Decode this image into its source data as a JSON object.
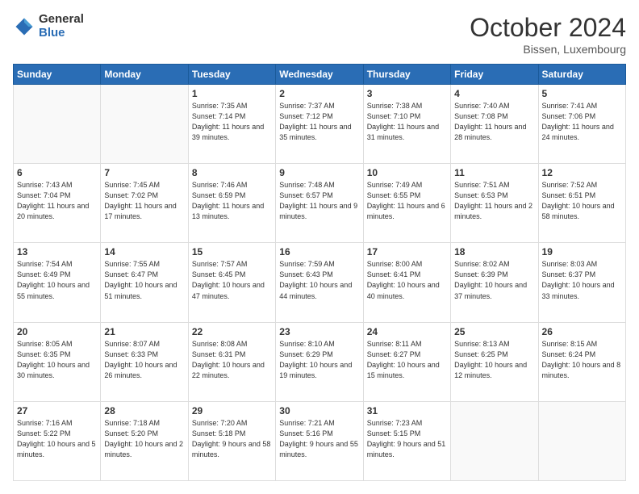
{
  "header": {
    "logo_general": "General",
    "logo_blue": "Blue",
    "month_title": "October 2024",
    "location": "Bissen, Luxembourg"
  },
  "days_of_week": [
    "Sunday",
    "Monday",
    "Tuesday",
    "Wednesday",
    "Thursday",
    "Friday",
    "Saturday"
  ],
  "weeks": [
    [
      {
        "day": "",
        "info": ""
      },
      {
        "day": "",
        "info": ""
      },
      {
        "day": "1",
        "info": "Sunrise: 7:35 AM\nSunset: 7:14 PM\nDaylight: 11 hours and 39 minutes."
      },
      {
        "day": "2",
        "info": "Sunrise: 7:37 AM\nSunset: 7:12 PM\nDaylight: 11 hours and 35 minutes."
      },
      {
        "day": "3",
        "info": "Sunrise: 7:38 AM\nSunset: 7:10 PM\nDaylight: 11 hours and 31 minutes."
      },
      {
        "day": "4",
        "info": "Sunrise: 7:40 AM\nSunset: 7:08 PM\nDaylight: 11 hours and 28 minutes."
      },
      {
        "day": "5",
        "info": "Sunrise: 7:41 AM\nSunset: 7:06 PM\nDaylight: 11 hours and 24 minutes."
      }
    ],
    [
      {
        "day": "6",
        "info": "Sunrise: 7:43 AM\nSunset: 7:04 PM\nDaylight: 11 hours and 20 minutes."
      },
      {
        "day": "7",
        "info": "Sunrise: 7:45 AM\nSunset: 7:02 PM\nDaylight: 11 hours and 17 minutes."
      },
      {
        "day": "8",
        "info": "Sunrise: 7:46 AM\nSunset: 6:59 PM\nDaylight: 11 hours and 13 minutes."
      },
      {
        "day": "9",
        "info": "Sunrise: 7:48 AM\nSunset: 6:57 PM\nDaylight: 11 hours and 9 minutes."
      },
      {
        "day": "10",
        "info": "Sunrise: 7:49 AM\nSunset: 6:55 PM\nDaylight: 11 hours and 6 minutes."
      },
      {
        "day": "11",
        "info": "Sunrise: 7:51 AM\nSunset: 6:53 PM\nDaylight: 11 hours and 2 minutes."
      },
      {
        "day": "12",
        "info": "Sunrise: 7:52 AM\nSunset: 6:51 PM\nDaylight: 10 hours and 58 minutes."
      }
    ],
    [
      {
        "day": "13",
        "info": "Sunrise: 7:54 AM\nSunset: 6:49 PM\nDaylight: 10 hours and 55 minutes."
      },
      {
        "day": "14",
        "info": "Sunrise: 7:55 AM\nSunset: 6:47 PM\nDaylight: 10 hours and 51 minutes."
      },
      {
        "day": "15",
        "info": "Sunrise: 7:57 AM\nSunset: 6:45 PM\nDaylight: 10 hours and 47 minutes."
      },
      {
        "day": "16",
        "info": "Sunrise: 7:59 AM\nSunset: 6:43 PM\nDaylight: 10 hours and 44 minutes."
      },
      {
        "day": "17",
        "info": "Sunrise: 8:00 AM\nSunset: 6:41 PM\nDaylight: 10 hours and 40 minutes."
      },
      {
        "day": "18",
        "info": "Sunrise: 8:02 AM\nSunset: 6:39 PM\nDaylight: 10 hours and 37 minutes."
      },
      {
        "day": "19",
        "info": "Sunrise: 8:03 AM\nSunset: 6:37 PM\nDaylight: 10 hours and 33 minutes."
      }
    ],
    [
      {
        "day": "20",
        "info": "Sunrise: 8:05 AM\nSunset: 6:35 PM\nDaylight: 10 hours and 30 minutes."
      },
      {
        "day": "21",
        "info": "Sunrise: 8:07 AM\nSunset: 6:33 PM\nDaylight: 10 hours and 26 minutes."
      },
      {
        "day": "22",
        "info": "Sunrise: 8:08 AM\nSunset: 6:31 PM\nDaylight: 10 hours and 22 minutes."
      },
      {
        "day": "23",
        "info": "Sunrise: 8:10 AM\nSunset: 6:29 PM\nDaylight: 10 hours and 19 minutes."
      },
      {
        "day": "24",
        "info": "Sunrise: 8:11 AM\nSunset: 6:27 PM\nDaylight: 10 hours and 15 minutes."
      },
      {
        "day": "25",
        "info": "Sunrise: 8:13 AM\nSunset: 6:25 PM\nDaylight: 10 hours and 12 minutes."
      },
      {
        "day": "26",
        "info": "Sunrise: 8:15 AM\nSunset: 6:24 PM\nDaylight: 10 hours and 8 minutes."
      }
    ],
    [
      {
        "day": "27",
        "info": "Sunrise: 7:16 AM\nSunset: 5:22 PM\nDaylight: 10 hours and 5 minutes."
      },
      {
        "day": "28",
        "info": "Sunrise: 7:18 AM\nSunset: 5:20 PM\nDaylight: 10 hours and 2 minutes."
      },
      {
        "day": "29",
        "info": "Sunrise: 7:20 AM\nSunset: 5:18 PM\nDaylight: 9 hours and 58 minutes."
      },
      {
        "day": "30",
        "info": "Sunrise: 7:21 AM\nSunset: 5:16 PM\nDaylight: 9 hours and 55 minutes."
      },
      {
        "day": "31",
        "info": "Sunrise: 7:23 AM\nSunset: 5:15 PM\nDaylight: 9 hours and 51 minutes."
      },
      {
        "day": "",
        "info": ""
      },
      {
        "day": "",
        "info": ""
      }
    ]
  ]
}
